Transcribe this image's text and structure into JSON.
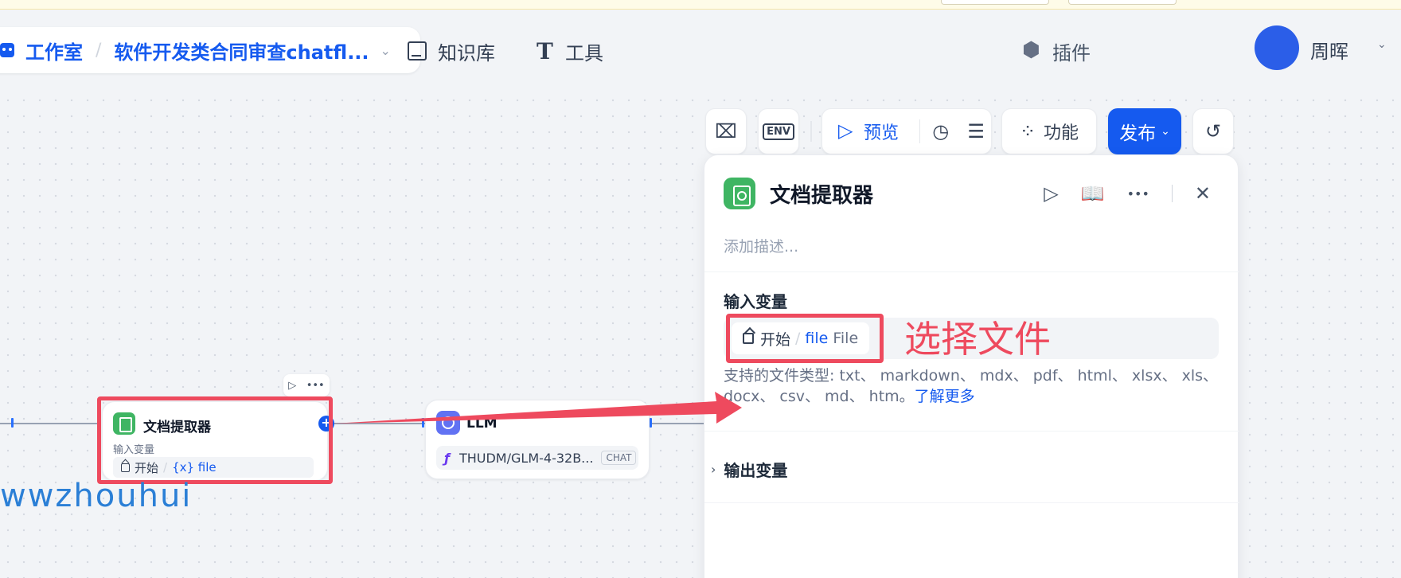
{
  "header": {
    "studio_label": "工作室",
    "separator": "/",
    "app_name": "软件开发类合同审查chatfl...",
    "nav": [
      {
        "label": "知识库",
        "icon": "book-icon"
      },
      {
        "label": "工具",
        "icon": "tool-icon"
      }
    ],
    "plugins_label": "插件",
    "user_name": "周晖"
  },
  "toolbar": {
    "env_label": "ENV",
    "preview_label": "预览",
    "features_label": "功能",
    "publish_label": "发布"
  },
  "panel": {
    "title": "文档提取器",
    "description_placeholder": "添加描述...",
    "input_section_title": "输入变量",
    "input_var": {
      "source": "开始",
      "separator": "/",
      "name": "file",
      "type": "File"
    },
    "support_text": "支持的文件类型: txt、 markdown、 mdx、 pdf、 html、 xlsx、 xls、 docx、 csv、 md、 htm。",
    "learn_more": "了解更多",
    "output_section_title": "输出变量"
  },
  "annotation": {
    "text": "选择文件",
    "color": "#ee4a5e"
  },
  "canvas": {
    "extractor_node": {
      "title": "文档提取器",
      "input_label": "输入变量",
      "var_source": "开始",
      "var_separator": "/",
      "var_name": "{x} file"
    },
    "llm_node": {
      "title": "LLM",
      "model": "THUDM/GLM-4-32B...",
      "badge": "CHAT"
    }
  },
  "watermark": "wwzhouhui",
  "colors": {
    "primary": "#155aef",
    "node_green": "#3fb563",
    "llm_purple": "#6172f3"
  }
}
